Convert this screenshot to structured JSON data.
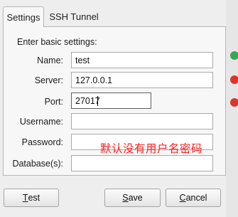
{
  "tabs": [
    {
      "label": "Settings",
      "active": true
    },
    {
      "label": "SSH Tunnel",
      "active": false
    }
  ],
  "form": {
    "heading": "Enter basic settings:",
    "fields": {
      "name": {
        "label": "Name:",
        "value": "test"
      },
      "server": {
        "label": "Server:",
        "value": "127.0.0.1"
      },
      "port": {
        "label": "Port:",
        "value": "27017"
      },
      "username": {
        "label": "Username:",
        "value": ""
      },
      "password": {
        "label": "Password:",
        "value": ""
      },
      "database": {
        "label": "Database(s):",
        "value": ""
      }
    }
  },
  "annotation": "默认没有用户名密码",
  "buttons": {
    "test": {
      "mnemonic": "T",
      "rest": "est"
    },
    "save": {
      "mnemonic": "S",
      "rest": "ave"
    },
    "cancel": {
      "mnemonic": "C",
      "rest": "ancel"
    }
  },
  "colors": {
    "annotation": "#ff2020",
    "side_green": "#3aa655",
    "side_red": "#d9372b"
  }
}
